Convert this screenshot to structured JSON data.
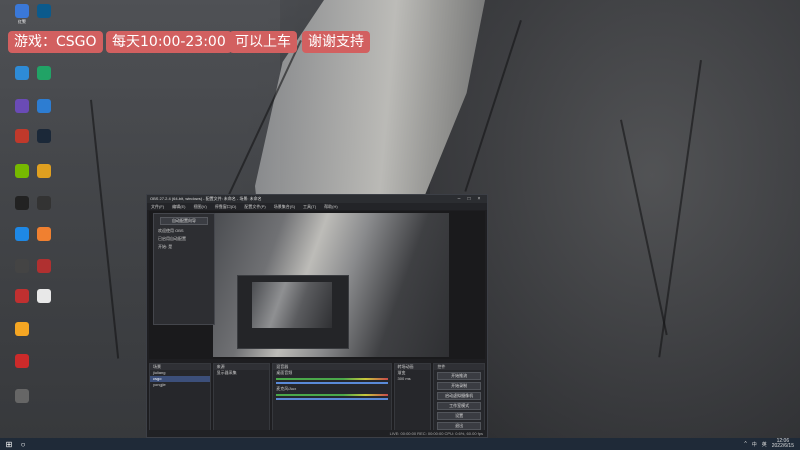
{
  "overlay": {
    "game": "游戏：CSGO",
    "schedule": "每天10:00-23:00",
    "ride": "可以上车",
    "thanks": "谢谢支持",
    "tag_color": "#d26060"
  },
  "desktop_icons": [
    {
      "icon": "app-icon",
      "color": "#3a78d8",
      "label": "红警"
    },
    {
      "icon": "app-icon",
      "color": "#0b5a8c",
      "label": ""
    },
    {
      "icon": "app-icon",
      "color": "#2e8bd6",
      "label": ""
    },
    {
      "icon": "app-icon",
      "color": "#21a366",
      "label": ""
    },
    {
      "icon": "app-icon",
      "color": "#6a4bb6",
      "label": ""
    },
    {
      "icon": "app-icon",
      "color": "#2d7dd2",
      "label": ""
    },
    {
      "icon": "app-icon",
      "color": "#c0392b",
      "label": ""
    },
    {
      "icon": "steam-icon",
      "color": "#1b2838",
      "label": ""
    },
    {
      "icon": "nvidia-icon",
      "color": "#76b900",
      "label": ""
    },
    {
      "icon": "app-icon",
      "color": "#e0a020",
      "label": ""
    },
    {
      "icon": "app-icon",
      "color": "#222222",
      "label": ""
    },
    {
      "icon": "app-icon",
      "color": "#333333",
      "label": ""
    },
    {
      "icon": "edge-icon",
      "color": "#1e88e5",
      "label": ""
    },
    {
      "icon": "app-icon",
      "color": "#f08030",
      "label": ""
    },
    {
      "icon": "app-icon",
      "color": "#444444",
      "label": ""
    },
    {
      "icon": "app-icon",
      "color": "#b03030",
      "label": ""
    },
    {
      "icon": "app-icon",
      "color": "#c03030",
      "label": ""
    },
    {
      "icon": "file-icon",
      "color": "#e8e8e8",
      "label": ""
    },
    {
      "icon": "app-icon",
      "color": "#f5a623",
      "label": ""
    },
    {
      "icon": "app-icon",
      "color": "#cc2a2a",
      "label": ""
    },
    {
      "icon": "app-icon",
      "color": "#666666",
      "label": ""
    }
  ],
  "obs": {
    "title": "OBS 27.2.4 (64-bit, windows) - 配置文件: 未命名 - 场景: 未命名",
    "menu": [
      "文件(F)",
      "编辑(E)",
      "视图(V)",
      "停靠窗口(D)",
      "配置文件(P)",
      "场景集合(S)",
      "工具(T)",
      "帮助(H)"
    ],
    "dialog_button": "自动配置向导",
    "dialog_lines": [
      "欢迎使用 OBS",
      "已启用自动配置",
      "开始: 是"
    ],
    "docks": {
      "scenes": {
        "header": "场景",
        "items": [
          "jiuliang",
          "csgo",
          "yongjie"
        ],
        "selected": 1
      },
      "sources": {
        "header": "来源",
        "items": [
          "显示器采集"
        ]
      },
      "mixer": {
        "header": "混音器",
        "channels": [
          "桌面音频",
          "麦克风/Aux"
        ]
      },
      "transitions": {
        "header": "转场动画",
        "items": [
          "渐变",
          "300 ms"
        ]
      },
      "controls": {
        "header": "控件",
        "buttons": [
          "开始推流",
          "开始录制",
          "启动虚拟摄像机",
          "工作室模式",
          "设置",
          "退出"
        ]
      }
    },
    "status": "LIVE: 00:00:00  REC: 00:00:00  CPU: 0.6%, 60.00 fps"
  },
  "taskbar": {
    "time": "12:06",
    "date": "2022/6/15",
    "tray": [
      "^",
      "中",
      "英"
    ]
  }
}
